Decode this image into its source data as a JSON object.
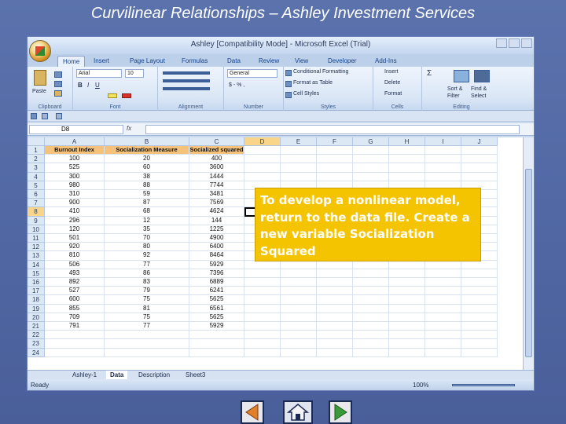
{
  "slide": {
    "title": "Curvilinear Relationships – Ashley Investment Services",
    "callout": "To develop a nonlinear model, return to the data file. Create a new variable Socialization Squared"
  },
  "excel": {
    "window_title": "Ashley  [Compatibility Mode]  -  Microsoft Excel (Trial)",
    "tabs": [
      "Home",
      "Insert",
      "Page Layout",
      "Formulas",
      "Data",
      "Review",
      "View",
      "Developer",
      "Add-Ins"
    ],
    "active_tab": "Home",
    "ribbon": {
      "clipboard": {
        "label": "Clipboard",
        "paste": "Paste"
      },
      "font": {
        "label": "Font",
        "name": "Arial",
        "size": "10"
      },
      "alignment": {
        "label": "Alignment"
      },
      "number": {
        "label": "Number",
        "format": "General",
        "currency": "$ - % ,"
      },
      "styles": {
        "label": "Styles",
        "items": [
          "Conditional Formatting",
          "Format as Table",
          "Cell Styles"
        ]
      },
      "cells": {
        "label": "Cells",
        "items": [
          "Insert",
          "Delete",
          "Format"
        ]
      },
      "editing": {
        "label": "Editing",
        "sort": "Sort & Filter",
        "find": "Find & Select",
        "sum": "Σ"
      }
    },
    "name_box": "D8",
    "fx": "fx",
    "columns": [
      "A",
      "B",
      "C",
      "D",
      "E",
      "F",
      "G",
      "H",
      "I",
      "J"
    ],
    "headers": [
      "Burnout Index",
      "Socialization Measure",
      "Socialized squared"
    ],
    "rows": [
      [
        "100",
        "20",
        "400"
      ],
      [
        "525",
        "60",
        "3600"
      ],
      [
        "300",
        "38",
        "1444"
      ],
      [
        "980",
        "88",
        "7744"
      ],
      [
        "310",
        "59",
        "3481"
      ],
      [
        "900",
        "87",
        "7569"
      ],
      [
        "410",
        "68",
        "4624"
      ],
      [
        "296",
        "12",
        "144"
      ],
      [
        "120",
        "35",
        "1225"
      ],
      [
        "501",
        "70",
        "4900"
      ],
      [
        "920",
        "80",
        "6400"
      ],
      [
        "810",
        "92",
        "8464"
      ],
      [
        "506",
        "77",
        "5929"
      ],
      [
        "493",
        "86",
        "7396"
      ],
      [
        "892",
        "83",
        "6889"
      ],
      [
        "527",
        "79",
        "6241"
      ],
      [
        "600",
        "75",
        "5625"
      ],
      [
        "855",
        "81",
        "6561"
      ],
      [
        "709",
        "75",
        "5625"
      ],
      [
        "791",
        "77",
        "5929"
      ]
    ],
    "extra_rows": [
      "22",
      "23",
      "24"
    ],
    "sheet_tabs": [
      "Ashley-1",
      "Data",
      "Description",
      "Sheet3"
    ],
    "active_sheet": "Data",
    "status": "Ready",
    "zoom": "100%"
  }
}
